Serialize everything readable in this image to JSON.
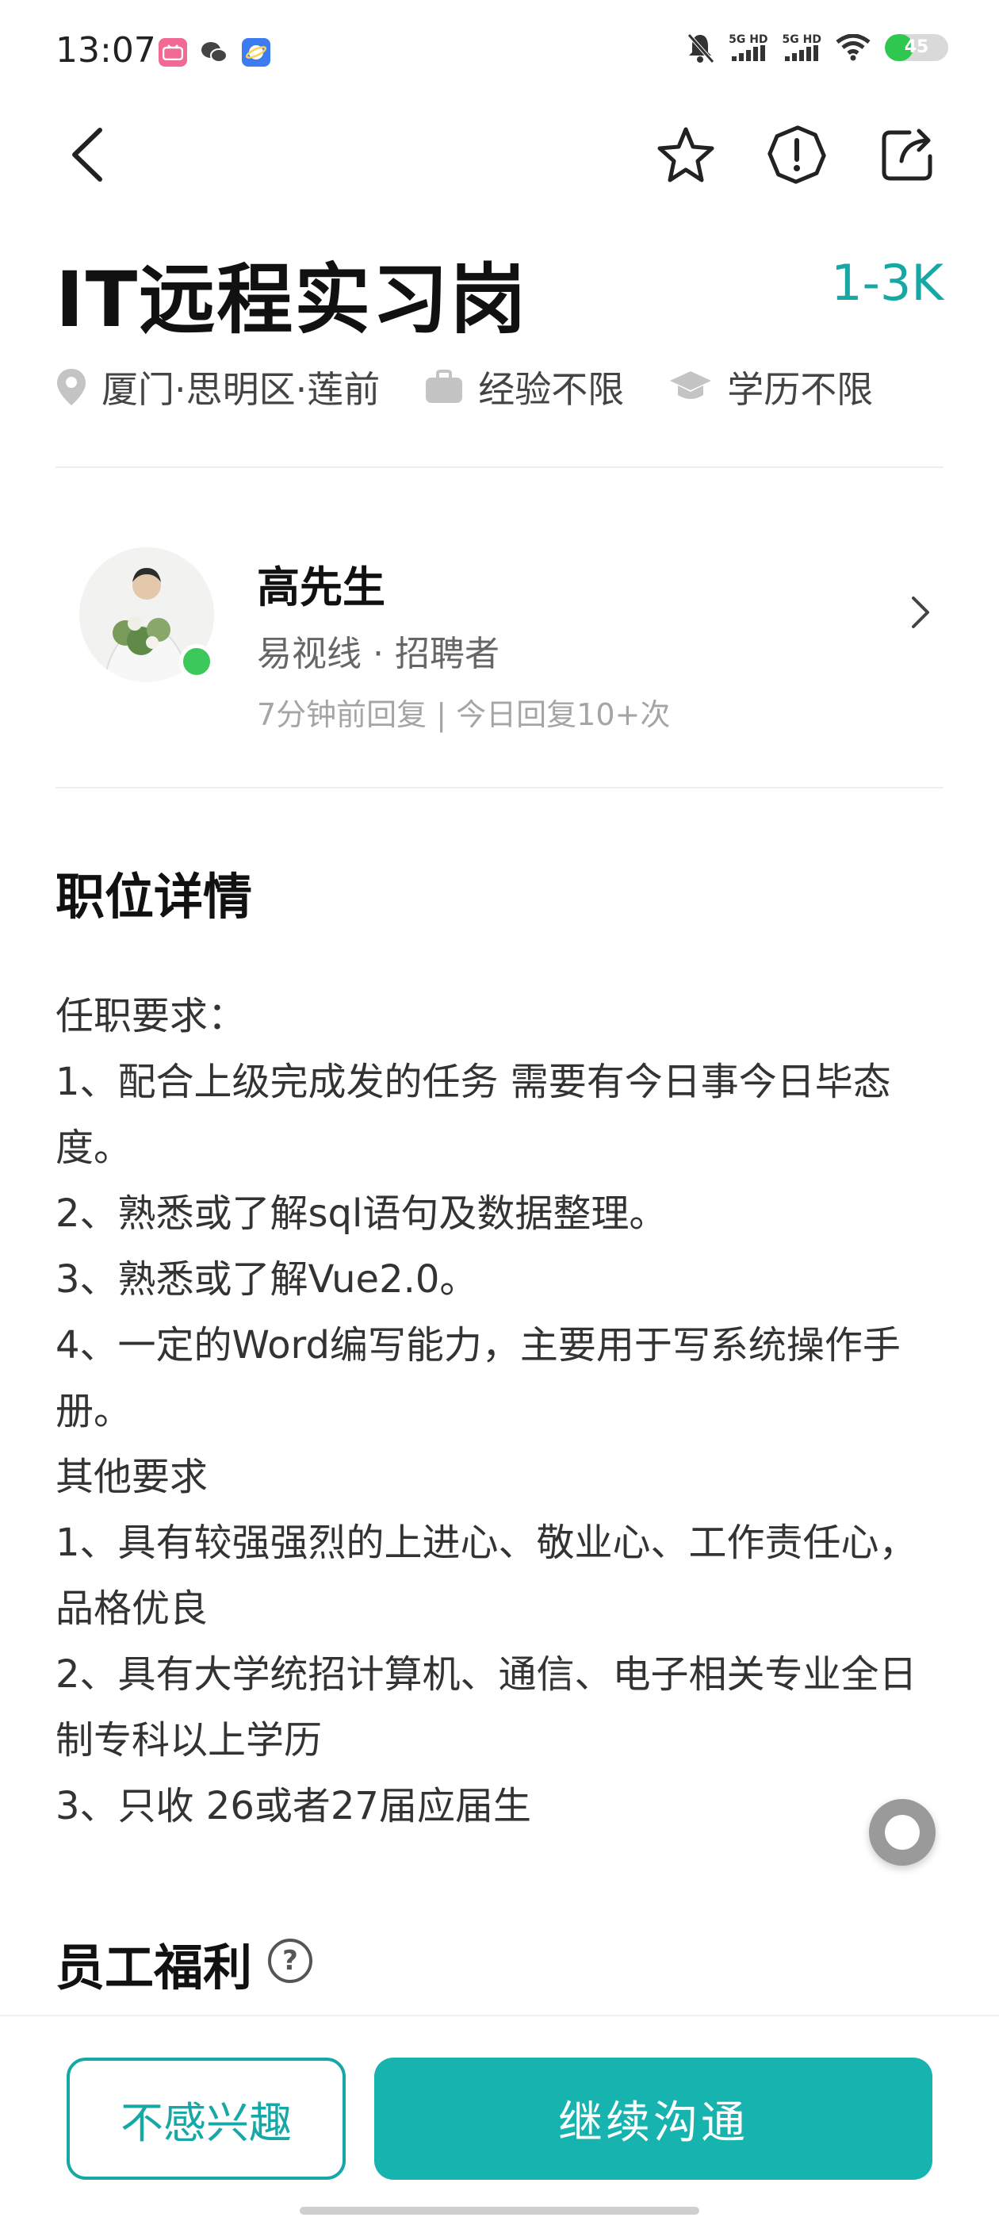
{
  "status_bar": {
    "time": "13:07",
    "signal1": "5G HD",
    "signal2": "5G HD",
    "battery": "45",
    "battery_level": 0.45
  },
  "nav": {
    "back_icon": "chevron-left-icon",
    "star_icon": "star-icon",
    "warning_icon": "alert-icon",
    "share_icon": "share-icon"
  },
  "job": {
    "title": "IT远程实习岗",
    "salary": "1-3K",
    "location": "厦门·思明区·莲前",
    "experience": "经验不限",
    "education": "学历不限"
  },
  "recruiter": {
    "name": "高先生",
    "company_role": "易视线 · 招聘者",
    "reply_info": "7分钟前回复 | 今日回复10+次"
  },
  "details": {
    "section_title": "职位详情",
    "lines": [
      "任职要求：",
      "1、配合上级完成发的任务 需要有今日事今日毕态度。",
      "2、熟悉或了解sql语句及数据整理。",
      "3、熟悉或了解Vue2.0。",
      "4、一定的Word编写能力，主要用于写系统操作手册。",
      "其他要求",
      "1、具有较强强烈的上进心、敬业心、工作责任心，品格优良",
      "2、具有大学统招计算机、通信、电子相关专业全日制专科以上学历",
      "3、只收 26或者27届应届生"
    ]
  },
  "benefits": {
    "section_title": "员工福利",
    "help_glyph": "?"
  },
  "actions": {
    "not_interested": "不感兴趣",
    "continue_chat": "继续沟通"
  },
  "colors": {
    "accent": "#17a8a6",
    "primary_button": "#17b3ae",
    "online": "#3cc85a"
  }
}
